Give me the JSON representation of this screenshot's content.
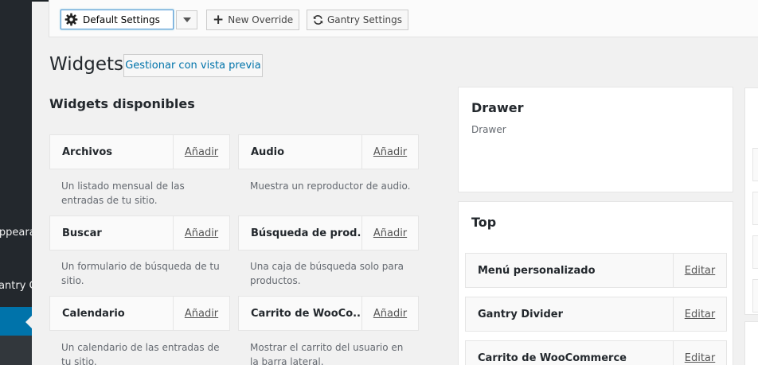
{
  "admin_sidebar": {
    "item_1": "Appearance",
    "item_2": "Gantry Console"
  },
  "toolbar": {
    "settings_select": "Default Settings",
    "new_override": "New Override",
    "gantry_settings": "Gantry Settings"
  },
  "page": {
    "title": "Widgets",
    "preview_button": "Gestionar con vista previa",
    "available_title": "Widgets disponibles"
  },
  "widgets": [
    {
      "name": "Archivos",
      "action": "Añadir",
      "description": "Un listado mensual de las entradas de tu sitio."
    },
    {
      "name": "Audio",
      "action": "Añadir",
      "description": "Muestra un reproductor de audio."
    },
    {
      "name": "Buscar",
      "action": "Añadir",
      "description": "Un formulario de búsqueda de tu sitio."
    },
    {
      "name": "Búsqueda de prod...",
      "action": "Añadir",
      "description": "Una caja de búsqueda solo para productos."
    },
    {
      "name": "Calendario",
      "action": "Añadir",
      "description": "Un calendario de las entradas de tu sitio."
    },
    {
      "name": "Carrito de WooCo...",
      "action": "Añadir",
      "description": "Mostrar el carrito del usuario en la barra lateral."
    }
  ],
  "areas": {
    "drawer": {
      "title": "Drawer",
      "description": "Drawer"
    },
    "top": {
      "title": "Top",
      "widgets": [
        {
          "name": "Menú personalizado",
          "action": "Editar"
        },
        {
          "name": "Gantry Divider",
          "action": "Editar"
        },
        {
          "name": "Carrito de WooCommerce",
          "action": "Editar"
        }
      ]
    }
  },
  "colors": {
    "admin_sidebar": "#23282d",
    "admin_active": "#0073aa",
    "link": "#0073aa",
    "background": "#f1f1f1"
  }
}
